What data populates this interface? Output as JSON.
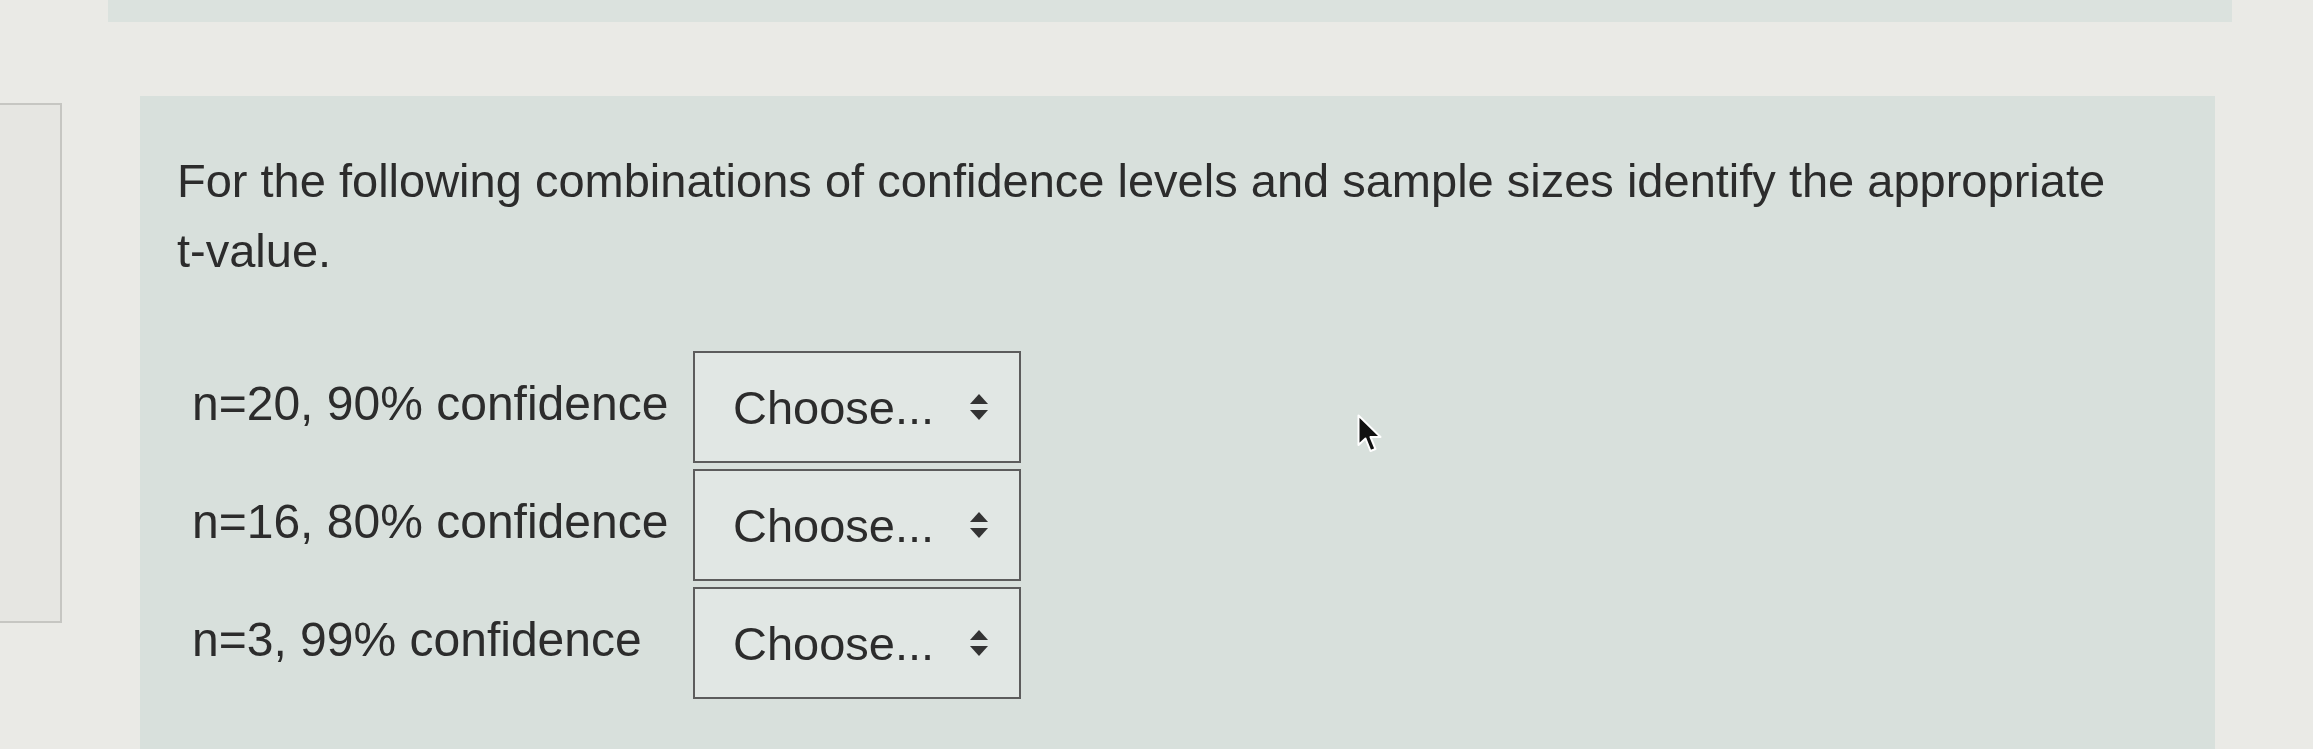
{
  "question": {
    "text": "For the following combinations of confidence levels and sample sizes identify the appropriate t-value."
  },
  "rows": [
    {
      "label": "n=20, 90% confidence",
      "dropdown_text": "Choose..."
    },
    {
      "label": "n=16, 80% confidence",
      "dropdown_text": "Choose..."
    },
    {
      "label": "n=3, 99% confidence",
      "dropdown_text": "Choose..."
    }
  ]
}
